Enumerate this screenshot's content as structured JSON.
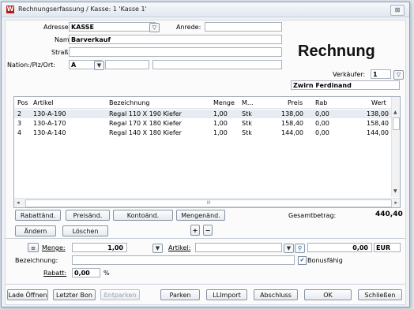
{
  "window": {
    "title": "Rechnungserfassung / Kasse: 1 'Kasse 1'",
    "icon_letter": "W",
    "close_symbol": "⊠"
  },
  "header": {
    "adresse_label": "Adresse:",
    "adresse_value": "KASSE",
    "anrede_label": "Anrede:",
    "anrede_value": "",
    "name_label": "Name:",
    "name_value": "Barverkauf",
    "strasse_label": "Straße:",
    "strasse_value": "",
    "nation_label": "Nation:/Plz/Ort:",
    "nation_value": "A",
    "plz_value": "",
    "ort_value": "",
    "doc_title": "Rechnung",
    "verkaeufer_label": "Verkäufer:",
    "verkaeufer_value": "1",
    "verkaeufer_name": "Zwirn Ferdinand"
  },
  "grid": {
    "columns": [
      "Pos",
      "Artikel",
      "Bezeichnung",
      "Menge",
      "M...",
      "Preis",
      "Rab",
      "Wert"
    ],
    "rows": [
      [
        "2",
        "130-A-190",
        "Regal 110 X 190 Kiefer",
        "1,00",
        "Stk",
        "138,00",
        "0,00",
        "138,00"
      ],
      [
        "3",
        "130-A-170",
        "Regal 170 X 180 Kiefer",
        "1,00",
        "Stk",
        "158,40",
        "0,00",
        "158,40"
      ],
      [
        "4",
        "130-A-140",
        "Regal 140 X 180 Kiefer",
        "1,00",
        "Stk",
        "144,00",
        "0,00",
        "144,00"
      ]
    ],
    "hscroll_marker": "III"
  },
  "actions": {
    "rabatt": "Rabattänd.",
    "preis": "Preisänd.",
    "konto": "Kontoänd.",
    "mengen": "Mengenänd.",
    "aendern": "Ändern",
    "loeschen": "Löschen",
    "plus": "+",
    "minus": "−"
  },
  "total": {
    "label": "Gesamtbetrag:",
    "value": "440,40"
  },
  "entry": {
    "menge_label": "Menge:",
    "menge_value": "1,00",
    "artikel_label": "Artikel:",
    "artikel_value": "",
    "price_value": "0,00",
    "currency": "EUR",
    "bezeichnung_label": "Bezeichnung:",
    "bezeichnung_value": "",
    "bonus_label": "Bonusfähig",
    "rabatt_label": "Rabatt:",
    "rabatt_value": "0,00",
    "rabatt_unit": "%"
  },
  "footer": {
    "lade_oeffnen": "Lade Öffnen",
    "letzter_bon": "Letzter Bon",
    "entparken": "Entparken",
    "parken": "Parken",
    "ll_import": "LLImport",
    "abschluss": "Abschluss",
    "ok": "OK",
    "schliessen": "Schließen"
  }
}
